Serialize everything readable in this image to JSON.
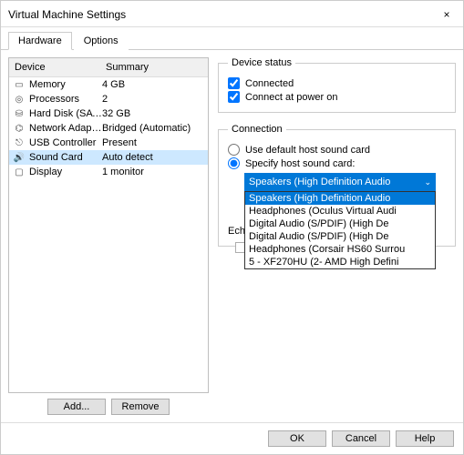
{
  "window": {
    "title": "Virtual Machine Settings",
    "close_label": "×"
  },
  "tabs": {
    "hardware": "Hardware",
    "options": "Options"
  },
  "device_table": {
    "head_device": "Device",
    "head_summary": "Summary",
    "rows": [
      {
        "icon": "memory",
        "name": "Memory",
        "summary": "4 GB"
      },
      {
        "icon": "processor",
        "name": "Processors",
        "summary": "2"
      },
      {
        "icon": "harddisk",
        "name": "Hard Disk (SATA)",
        "summary": "32 GB"
      },
      {
        "icon": "network",
        "name": "Network Adapter",
        "summary": "Bridged (Automatic)"
      },
      {
        "icon": "usb",
        "name": "USB Controller",
        "summary": "Present"
      },
      {
        "icon": "sound",
        "name": "Sound Card",
        "summary": "Auto detect"
      },
      {
        "icon": "display",
        "name": "Display",
        "summary": "1 monitor"
      }
    ],
    "selected_index": 5
  },
  "buttons": {
    "add": "Add...",
    "remove": "Remove",
    "ok": "OK",
    "cancel": "Cancel",
    "help": "Help"
  },
  "device_status": {
    "legend": "Device status",
    "connected_label": "Connected",
    "connected": true,
    "connect_at_poweron_label": "Connect at power on",
    "connect_at_poweron": true
  },
  "connection": {
    "legend": "Connection",
    "use_default_label": "Use default host sound card",
    "specify_label": "Specify host sound card:",
    "mode": "specify",
    "selected_value": "Speakers (High Definition Audio",
    "options": [
      "Speakers (High Definition Audio",
      "Headphones (Oculus Virtual Audi",
      "Digital Audio (S/PDIF) (High De",
      "Digital Audio (S/PDIF) (High De",
      "Headphones (Corsair HS60 Surrou",
      "5 - XF270HU (2- AMD High Defini"
    ],
    "highlight_index": 0
  },
  "echo": {
    "legend_partial": "Ech"
  }
}
